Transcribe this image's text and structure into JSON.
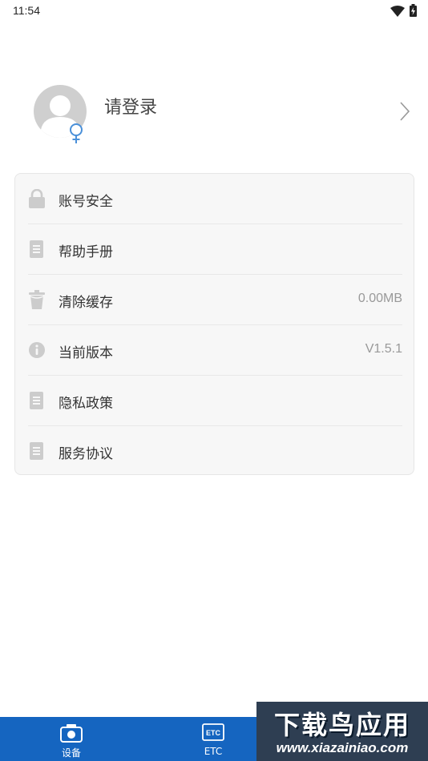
{
  "status_bar": {
    "time": "11:54",
    "wifi_icon": "wifi-icon",
    "battery_icon": "battery-charging-icon"
  },
  "profile": {
    "login_text": "请登录",
    "avatar_icon": "avatar-icon",
    "gender_icon": "female-gender-icon",
    "arrow_icon": "chevron-right-icon"
  },
  "menu": {
    "items": [
      {
        "label": "账号安全",
        "icon": "lock-icon",
        "value": ""
      },
      {
        "label": "帮助手册",
        "icon": "document-icon",
        "value": ""
      },
      {
        "label": "清除缓存",
        "icon": "trash-icon",
        "value": "0.00MB"
      },
      {
        "label": "当前版本",
        "icon": "info-icon",
        "value": "V1.5.1"
      },
      {
        "label": "隐私政策",
        "icon": "document-icon",
        "value": ""
      },
      {
        "label": "服务协议",
        "icon": "document-icon",
        "value": ""
      }
    ]
  },
  "bottom_nav": {
    "items": [
      {
        "label": "设备",
        "icon": "device-camera-icon"
      },
      {
        "label": "ETC",
        "icon": "etc-card-icon"
      }
    ]
  },
  "watermark": {
    "title": "下载鸟应用",
    "url": "www.xiazainiao.com"
  },
  "colors": {
    "accent": "#1565c0",
    "icon_gray": "#cccccc",
    "card_bg": "#f7f7f7",
    "gender_blue": "#4a90d9"
  }
}
